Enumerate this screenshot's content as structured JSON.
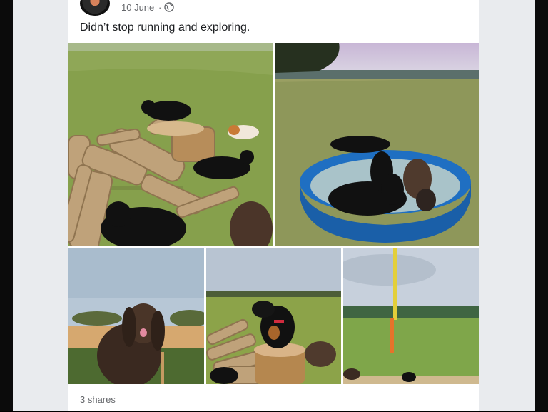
{
  "post": {
    "date": "10 June",
    "separator": "·",
    "caption": "Didn’t stop running and exploring.",
    "shares": "3 shares"
  },
  "icons": {
    "avatar": "profile-avatar",
    "audience": "globe-icon"
  },
  "colors": {
    "card": "#ffffff",
    "feed_background": "#e9ebee",
    "secondary_text": "#65676b",
    "primary_text": "#1c1e21",
    "pool_blue": "#1f6fc2",
    "grass": "#7f9a45"
  },
  "photos": [
    {
      "subject": "puppies-on-log-pile"
    },
    {
      "subject": "puppies-in-paddling-pool"
    },
    {
      "subject": "spaniel-by-fence"
    },
    {
      "subject": "black-tan-puppy-on-stump"
    },
    {
      "subject": "field-with-marker-pole"
    }
  ]
}
